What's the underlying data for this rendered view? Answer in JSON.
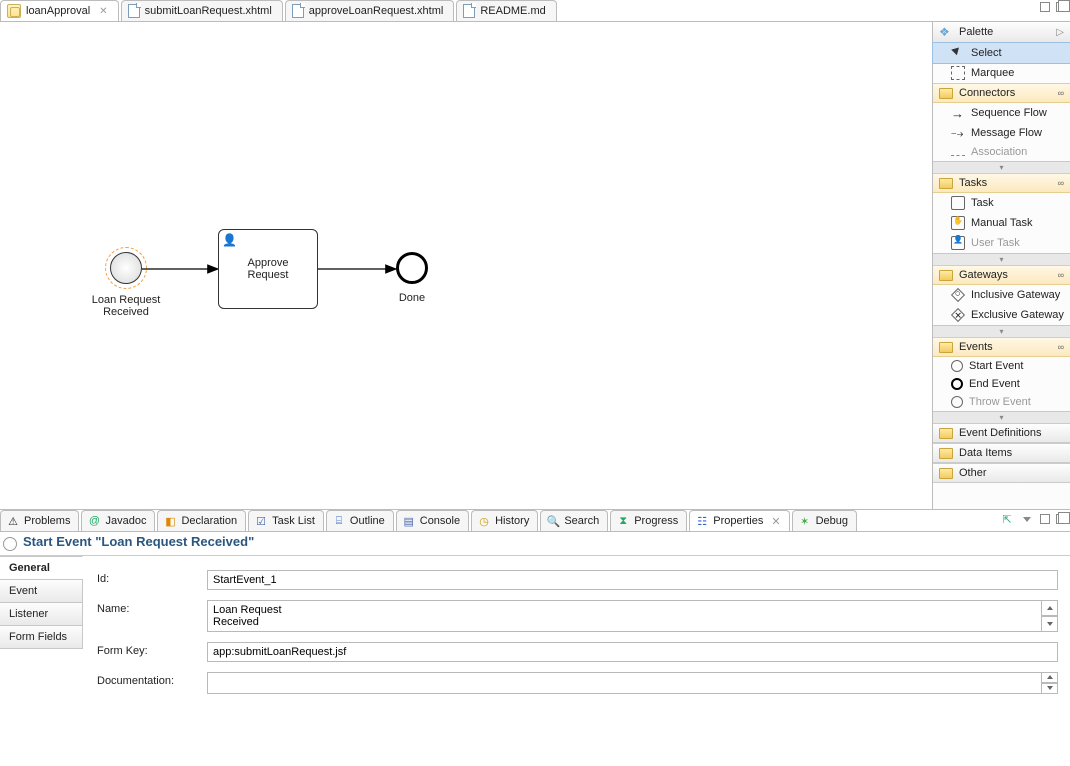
{
  "tabs": {
    "t0": "loanApproval",
    "t1": "submitLoanRequest.xhtml",
    "t2": "approveLoanRequest.xhtml",
    "t3": "README.md"
  },
  "bpmn": {
    "start_label": "Loan Request\nReceived",
    "task_label": "Approve\nRequest",
    "end_label": "Done"
  },
  "palette": {
    "title": "Palette",
    "select": "Select",
    "marquee": "Marquee",
    "drawers": {
      "connectors": "Connectors",
      "tasks": "Tasks",
      "gateways": "Gateways",
      "events": "Events",
      "eventdefs": "Event Definitions",
      "dataitems": "Data Items",
      "other": "Other"
    },
    "items": {
      "seqflow": "Sequence Flow",
      "msgflow": "Message Flow",
      "assoc": "Association",
      "task": "Task",
      "mtask": "Manual Task",
      "utask": "User Task",
      "incgw": "Inclusive Gateway",
      "excgw": "Exclusive Gateway",
      "startevt": "Start Event",
      "endevt": "End Event",
      "throwevt": "Throw Event"
    }
  },
  "views": {
    "problems": "Problems",
    "javadoc": "Javadoc",
    "declaration": "Declaration",
    "tasklist": "Task List",
    "outline": "Outline",
    "console": "Console",
    "history": "History",
    "search": "Search",
    "progress": "Progress",
    "properties": "Properties",
    "debug": "Debug"
  },
  "properties": {
    "title": "Start Event \"Loan Request Received\"",
    "tabs": {
      "general": "General",
      "event": "Event",
      "listener": "Listener",
      "formfields": "Form Fields"
    },
    "labels": {
      "id": "Id:",
      "name": "Name:",
      "formkey": "Form Key:",
      "documentation": "Documentation:"
    },
    "values": {
      "id": "StartEvent_1",
      "name": "Loan Request\nReceived",
      "formkey": "app:submitLoanRequest.jsf",
      "documentation": ""
    }
  }
}
